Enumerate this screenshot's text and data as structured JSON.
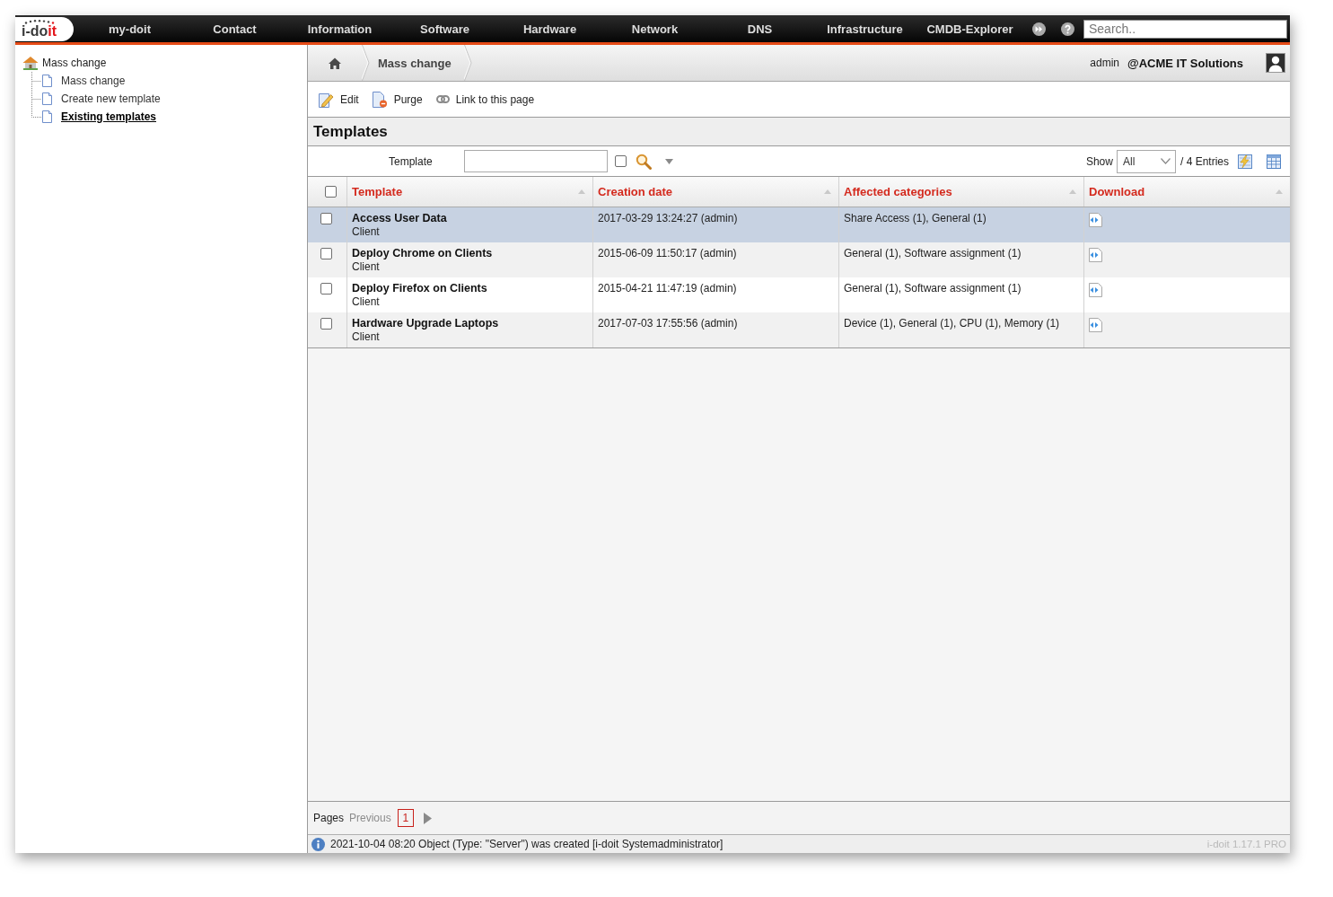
{
  "top_nav": {
    "logo": {
      "main": "i-do",
      "accent": "it"
    },
    "items": [
      "my-doit",
      "Contact",
      "Information",
      "Software",
      "Hardware",
      "Network",
      "DNS",
      "Infrastructure",
      "CMDB-Explorer"
    ],
    "search": {
      "placeholder": "Search.."
    }
  },
  "sidebar": {
    "tree": [
      {
        "label": "Mass change",
        "children": [
          {
            "label": "Mass change",
            "selected": false
          },
          {
            "label": "Create new template",
            "selected": false
          },
          {
            "label": "Existing templates",
            "selected": true
          }
        ]
      }
    ]
  },
  "breadcrumb": {
    "items": [
      "Mass change"
    ],
    "user": "admin",
    "tenant": "@ACME IT Solutions"
  },
  "toolbar": [
    {
      "kind": "edit",
      "label": "Edit"
    },
    {
      "kind": "purge",
      "label": "Purge"
    },
    {
      "kind": "link",
      "label": "Link to this page"
    }
  ],
  "section_title": "Templates",
  "filter": {
    "label": "Template",
    "checked": false,
    "show_label": "Show",
    "show_value": "All",
    "entries": "/ 4 Entries"
  },
  "table": {
    "select_all_checked": false,
    "columns": [
      "Template",
      "Creation date",
      "Affected categories",
      "Download"
    ],
    "rows": [
      {
        "selected": true,
        "checked": false,
        "name": "Access User Data",
        "type": "Client",
        "creation_date": "2017-03-29 13:24:27 (admin)",
        "affected_categories": "Share Access (1), General (1)"
      },
      {
        "selected": false,
        "checked": false,
        "name": "Deploy Chrome on Clients",
        "type": "Client",
        "creation_date": "2015-06-09 11:50:17 (admin)",
        "affected_categories": "General (1), Software assignment (1)"
      },
      {
        "selected": false,
        "checked": false,
        "name": "Deploy Firefox on Clients",
        "type": "Client",
        "creation_date": "2015-04-21 11:47:19 (admin)",
        "affected_categories": "General (1), Software assignment (1)"
      },
      {
        "selected": false,
        "checked": false,
        "name": "Hardware Upgrade Laptops",
        "type": "Client",
        "creation_date": "2017-07-03 17:55:56 (admin)",
        "affected_categories": "Device (1), General (1), CPU (1), Memory (1)"
      }
    ]
  },
  "pagination": {
    "label": "Pages",
    "previous": {
      "label": "Previous",
      "disabled": true
    },
    "pages": [
      {
        "label": "1",
        "selected": true
      }
    ]
  },
  "status_bar": {
    "message": "2021-10-04 08:20 Object (Type: \"Server\") was created [i-doit Systemadministrator]",
    "version": "i-doit 1.17.1 PRO"
  }
}
